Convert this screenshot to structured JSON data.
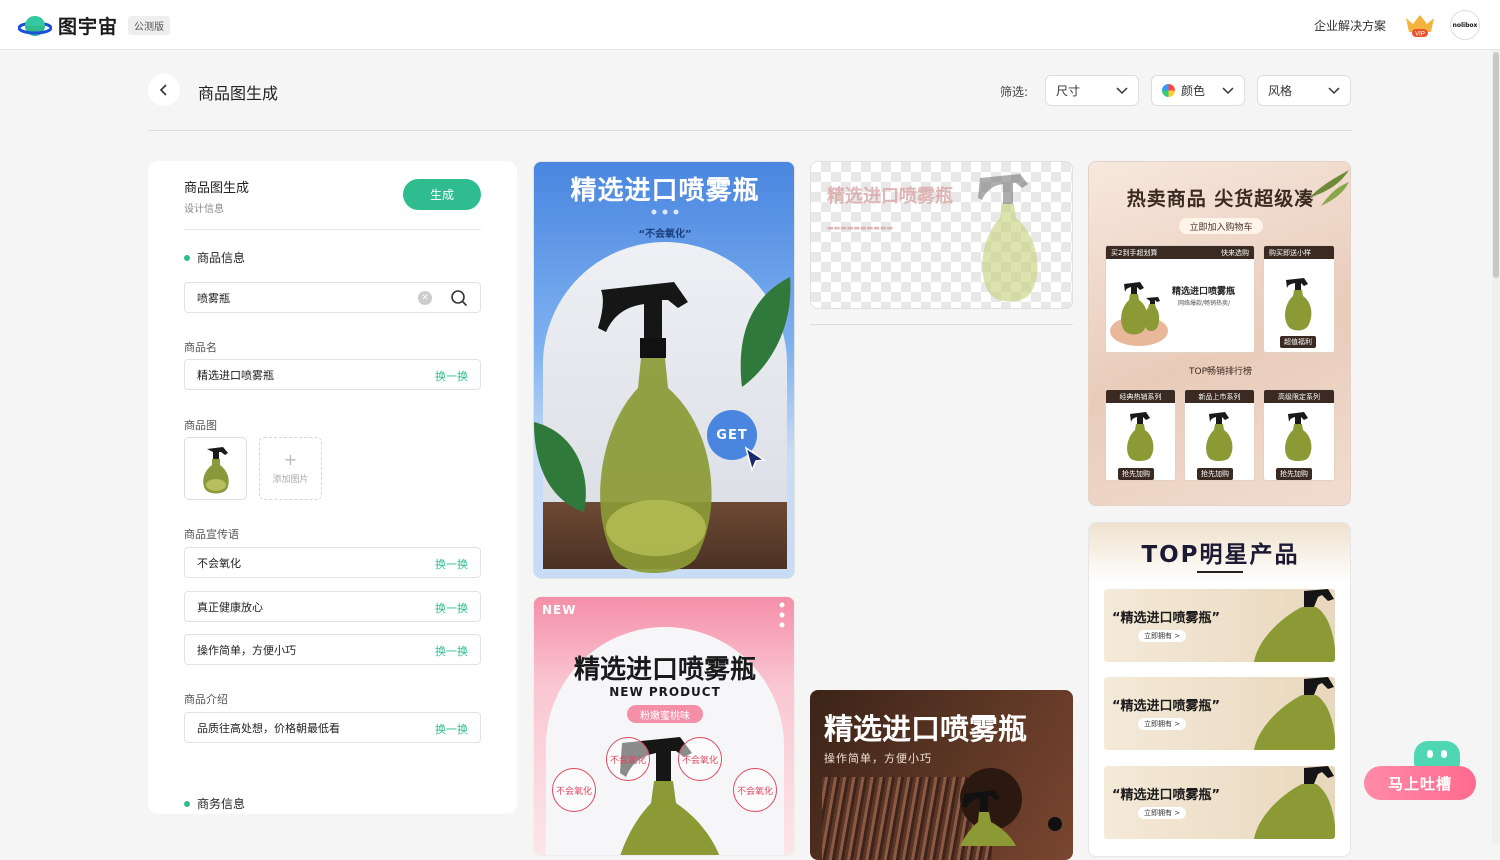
{
  "topbar": {
    "logo_text": "图宇宙",
    "badge": "公测版",
    "enterprise": "企业解决方案",
    "vip": "VIP",
    "avatar_text": "nolibox"
  },
  "header": {
    "title": "商品图生成",
    "filter_label": "筛选:",
    "filters": {
      "size": "尺寸",
      "color": "颜色",
      "style": "风格"
    }
  },
  "panel": {
    "title": "商品图生成",
    "subtitle": "设计信息",
    "generate": "生成",
    "product_info": "商品信息",
    "search_value": "喷雾瓶",
    "name_label": "商品名",
    "name_value": "精选进口喷雾瓶",
    "swap": "换一换",
    "image_label": "商品图",
    "add_image": "添加图片",
    "slogan_label": "商品宣传语",
    "slogans": [
      "不会氧化",
      "真正健康放心",
      "操作简单，方便小巧"
    ],
    "intro_label": "商品介绍",
    "intro_value": "品质往高处想，价格朝最低看",
    "business_info": "商务信息"
  },
  "cards": {
    "c1": {
      "title": "精选进口喷雾瓶",
      "subtitle": "“不会氧化”",
      "badge": "GET"
    },
    "c2": {
      "title": "精选进口喷雾瓶"
    },
    "c3": {
      "title": "热卖商品 尖货超级凑",
      "pill": "立即加入购物车",
      "box1_left": "买2到手超划算",
      "box1_right": "快来选购",
      "box1_product": "精选进口喷雾瓶",
      "box1_line": "网络爆款/畅销热卖/",
      "box2_head": "购买即送小样",
      "box2_tag": "超值福利",
      "rank": "TOP畅销排行榜",
      "series": [
        "经典热销系列",
        "新品上市系列",
        "高级限定系列"
      ],
      "buy": "抢先加购"
    },
    "c4": {
      "new": "NEW",
      "title": "精选进口喷雾瓶",
      "sub": "NEW PRODUCT",
      "pill": "粉嫩蜜桃味",
      "stamp": "不会氧化"
    },
    "c5": {
      "title": "精选进口喷雾瓶",
      "sub": "操作简单，方便小巧"
    },
    "c6": {
      "title": "TOP明星产品",
      "banner": "“精选进口喷雾瓶”",
      "button": "立即拥有 >"
    }
  },
  "feedback": {
    "label": "马上吐槽"
  },
  "colors": {
    "accent": "#2fbd8f",
    "blue_card": "#4a86e0",
    "pink": "#f58fa8"
  }
}
